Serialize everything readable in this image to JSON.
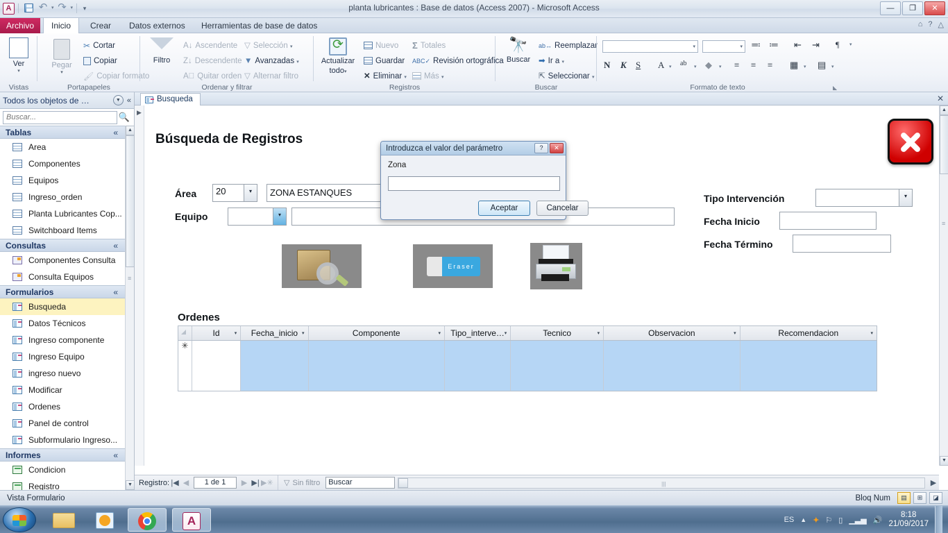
{
  "window": {
    "title": "planta lubricantes : Base de datos (Access 2007)  -  Microsoft Access",
    "logo": "A",
    "minimize": "—",
    "restore": "❐",
    "close": "✕"
  },
  "quick_access": {
    "save": "save-icon",
    "undo": "↶",
    "redo": "↷",
    "customize": "▾"
  },
  "ribbon": {
    "tabs": [
      {
        "label": "Archivo",
        "active": false
      },
      {
        "label": "Inicio",
        "active": true
      },
      {
        "label": "Crear",
        "active": false
      },
      {
        "label": "Datos externos",
        "active": false
      },
      {
        "label": "Herramientas de base de datos",
        "active": false
      }
    ],
    "groups": [
      {
        "title": "Vistas"
      },
      {
        "title": "Portapapeles"
      },
      {
        "title": "Ordenar y filtrar"
      },
      {
        "title": "Registros"
      },
      {
        "title": "Buscar"
      },
      {
        "title": "Formato de texto"
      }
    ],
    "vistas": {
      "ver": "Ver",
      "caret": "▾"
    },
    "portapapeles": {
      "pegar": "Pegar",
      "pegar_caret": "▾",
      "cortar": "Cortar",
      "copiar": "Copiar",
      "copiar_formato": "Copiar formato"
    },
    "ordenar": {
      "filtro": "Filtro",
      "ascendente": "Ascendente",
      "descendente": "Descendente",
      "quitar_orden": "Quitar orden",
      "seleccion": "Selección",
      "avanzadas": "Avanzadas",
      "alternar_filtro": "Alternar filtro"
    },
    "registros": {
      "actualizar_todo_l1": "Actualizar",
      "actualizar_todo_l2": "todo",
      "actualizar_caret": "▾",
      "nuevo": "Nuevo",
      "guardar": "Guardar",
      "eliminar": "Eliminar",
      "totales": "Totales",
      "revision": "Revisión ortográfica",
      "mas": "Más"
    },
    "buscar": {
      "buscar": "Buscar",
      "reemplazar": "Reemplazar",
      "ir_a": "Ir a",
      "seleccionar": "Seleccionar"
    },
    "formato": {
      "font_name": "",
      "font_size": "",
      "negrita": "N",
      "cursiva": "K",
      "subrayado": "S",
      "color_texto": "A",
      "resaltado": "ab",
      "relleno": "◆",
      "izquierda": "≡",
      "centro": "≡",
      "derecha": "≡",
      "cuadricula": "▦",
      "color_alterno": "▤",
      "numeracion": "≔",
      "vinetas": "≕",
      "sangria_mas": "⇥",
      "sangria_menos": "⇤",
      "direccion": "¶"
    }
  },
  "navpane": {
    "title": "Todos los objetos de …",
    "menu_icon": "chevron-down-circle",
    "collapse_icon": "«",
    "search_placeholder": "Buscar...",
    "search_value": "",
    "search_icon": "search-icon",
    "groups": [
      {
        "label": "Tablas",
        "chevron": "«",
        "icon": "table-icon",
        "items": [
          "Area",
          "Componentes",
          "Equipos",
          "Ingreso_orden",
          "Planta Lubricantes Cop...",
          "Switchboard Items"
        ]
      },
      {
        "label": "Consultas",
        "chevron": "«",
        "icon": "query-icon",
        "items": [
          "Componentes Consulta",
          "Consulta Equipos"
        ]
      },
      {
        "label": "Formularios",
        "chevron": "«",
        "icon": "form-icon",
        "items": [
          "Busqueda",
          "Datos Técnicos",
          "Ingreso componente",
          "Ingreso Equipo",
          "ingreso nuevo",
          "Modificar",
          "Ordenes",
          "Panel de control",
          "Subformulario Ingreso..."
        ],
        "selected": "Busqueda"
      },
      {
        "label": "Informes",
        "chevron": "«",
        "icon": "report-icon",
        "items": [
          "Condicion",
          "Registro"
        ]
      }
    ]
  },
  "document": {
    "tab_label": "Busqueda",
    "close_label": "✕",
    "form_title": "Búsqueda de Registros",
    "fields": [
      {
        "label": "Área",
        "type": "combo",
        "value": "20",
        "caret": "▾"
      },
      {
        "label": "",
        "type": "text",
        "value": "ZONA ESTANQUES"
      },
      {
        "label": "Equipo",
        "type": "combo",
        "value": "",
        "caret": "▾"
      },
      {
        "label": "Tipo Intervención",
        "type": "combo",
        "value": "",
        "caret": "▾"
      },
      {
        "label": "Fecha Inicio",
        "type": "text",
        "value": ""
      },
      {
        "label": "Fecha Término",
        "type": "text",
        "value": ""
      }
    ],
    "image_buttons": [
      {
        "name": "search-cabinet-icon",
        "caption": ""
      },
      {
        "name": "eraser-icon",
        "caption": "Eraser"
      },
      {
        "name": "printer-icon",
        "caption": ""
      }
    ],
    "close_form_icon": "red-x-close-icon",
    "grid_title": "Ordenes",
    "grid": {
      "columns": [
        "Id",
        "Fecha_inicio",
        "Componente",
        "Tipo_interve…",
        "Tecnico",
        "Observacion",
        "Recomendacion"
      ],
      "column_caret": "▾",
      "new_row_marker": "✳",
      "rows": []
    }
  },
  "record_nav": {
    "label": "Registro:",
    "first": "|◀",
    "prev": "◀",
    "current": "1 de 1",
    "next": "▶",
    "last": "▶|",
    "new": "▶✳",
    "filter_icon": "filter-off-icon",
    "filter_label": "Sin filtro",
    "search_placeholder": "Buscar",
    "search_value": "Buscar"
  },
  "statusbar": {
    "view": "Vista Formulario",
    "numlock": "Bloq Num",
    "view_buttons": [
      {
        "name": "form-view-button",
        "glyph": "▤",
        "active": true
      },
      {
        "name": "layout-view-button",
        "glyph": "⊞",
        "active": false
      },
      {
        "name": "design-view-button",
        "glyph": "◪",
        "active": false
      }
    ]
  },
  "taskbar": {
    "start": "start-orb",
    "items": [
      {
        "name": "taskbar-explorer",
        "active": false
      },
      {
        "name": "taskbar-media-player",
        "active": false
      },
      {
        "name": "taskbar-chrome",
        "active": true
      },
      {
        "name": "taskbar-access",
        "active": true
      }
    ],
    "tray": {
      "language": "ES",
      "expand": "▲",
      "icons": [
        "avast-icon",
        "flag-icon",
        "battery-icon",
        "network-icon",
        "volume-icon"
      ],
      "time": "8:18",
      "date": "21/09/2017"
    }
  },
  "dialog": {
    "title": "Introduzca el valor del parámetro",
    "help_button": "?",
    "close_button": "✕",
    "field_label": "Zona",
    "field_value": "",
    "accept": "Aceptar",
    "cancel": "Cancelar"
  },
  "colors": {
    "accent": "#a4235a",
    "selection": "#b6d6f5",
    "selected_item": "#fdf3c0",
    "close_red": "#cf0000"
  }
}
